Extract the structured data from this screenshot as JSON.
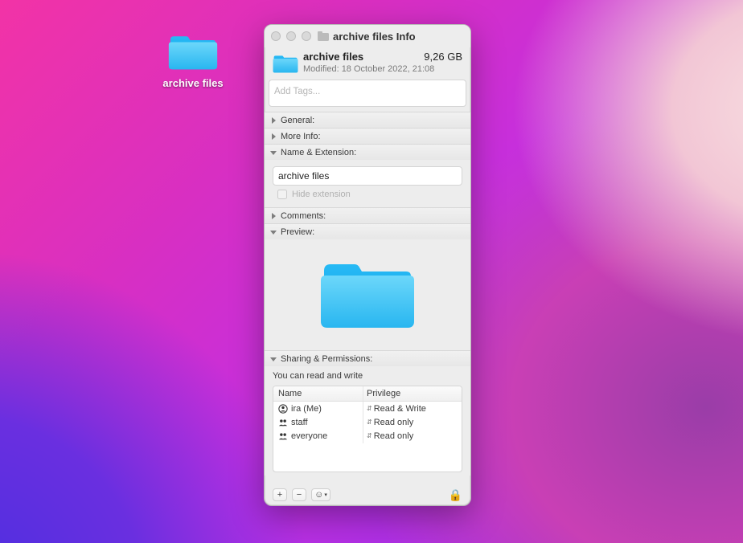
{
  "desktop": {
    "folder_label": "archive files"
  },
  "window": {
    "title": "archive files Info"
  },
  "header": {
    "name": "archive files",
    "size": "9,26 GB",
    "modified": "Modified: 18 October 2022, 21:08"
  },
  "tags": {
    "placeholder": "Add Tags..."
  },
  "sections": {
    "general": "General:",
    "more_info": "More Info:",
    "name_ext": "Name & Extension:",
    "comments": "Comments:",
    "preview": "Preview:",
    "sharing": "Sharing & Permissions:"
  },
  "name_ext": {
    "value": "archive files",
    "hide_ext_label": "Hide extension"
  },
  "sharing": {
    "hint": "You can read and write",
    "columns": {
      "name": "Name",
      "privilege": "Privilege"
    },
    "rows": [
      {
        "name": "ira (Me)",
        "privilege": "Read & Write",
        "icon": "user"
      },
      {
        "name": "staff",
        "privilege": "Read only",
        "icon": "group"
      },
      {
        "name": "everyone",
        "privilege": "Read only",
        "icon": "group"
      }
    ]
  },
  "footer": {
    "add": "+",
    "remove": "−",
    "action": "☺",
    "lock": "🔒"
  }
}
